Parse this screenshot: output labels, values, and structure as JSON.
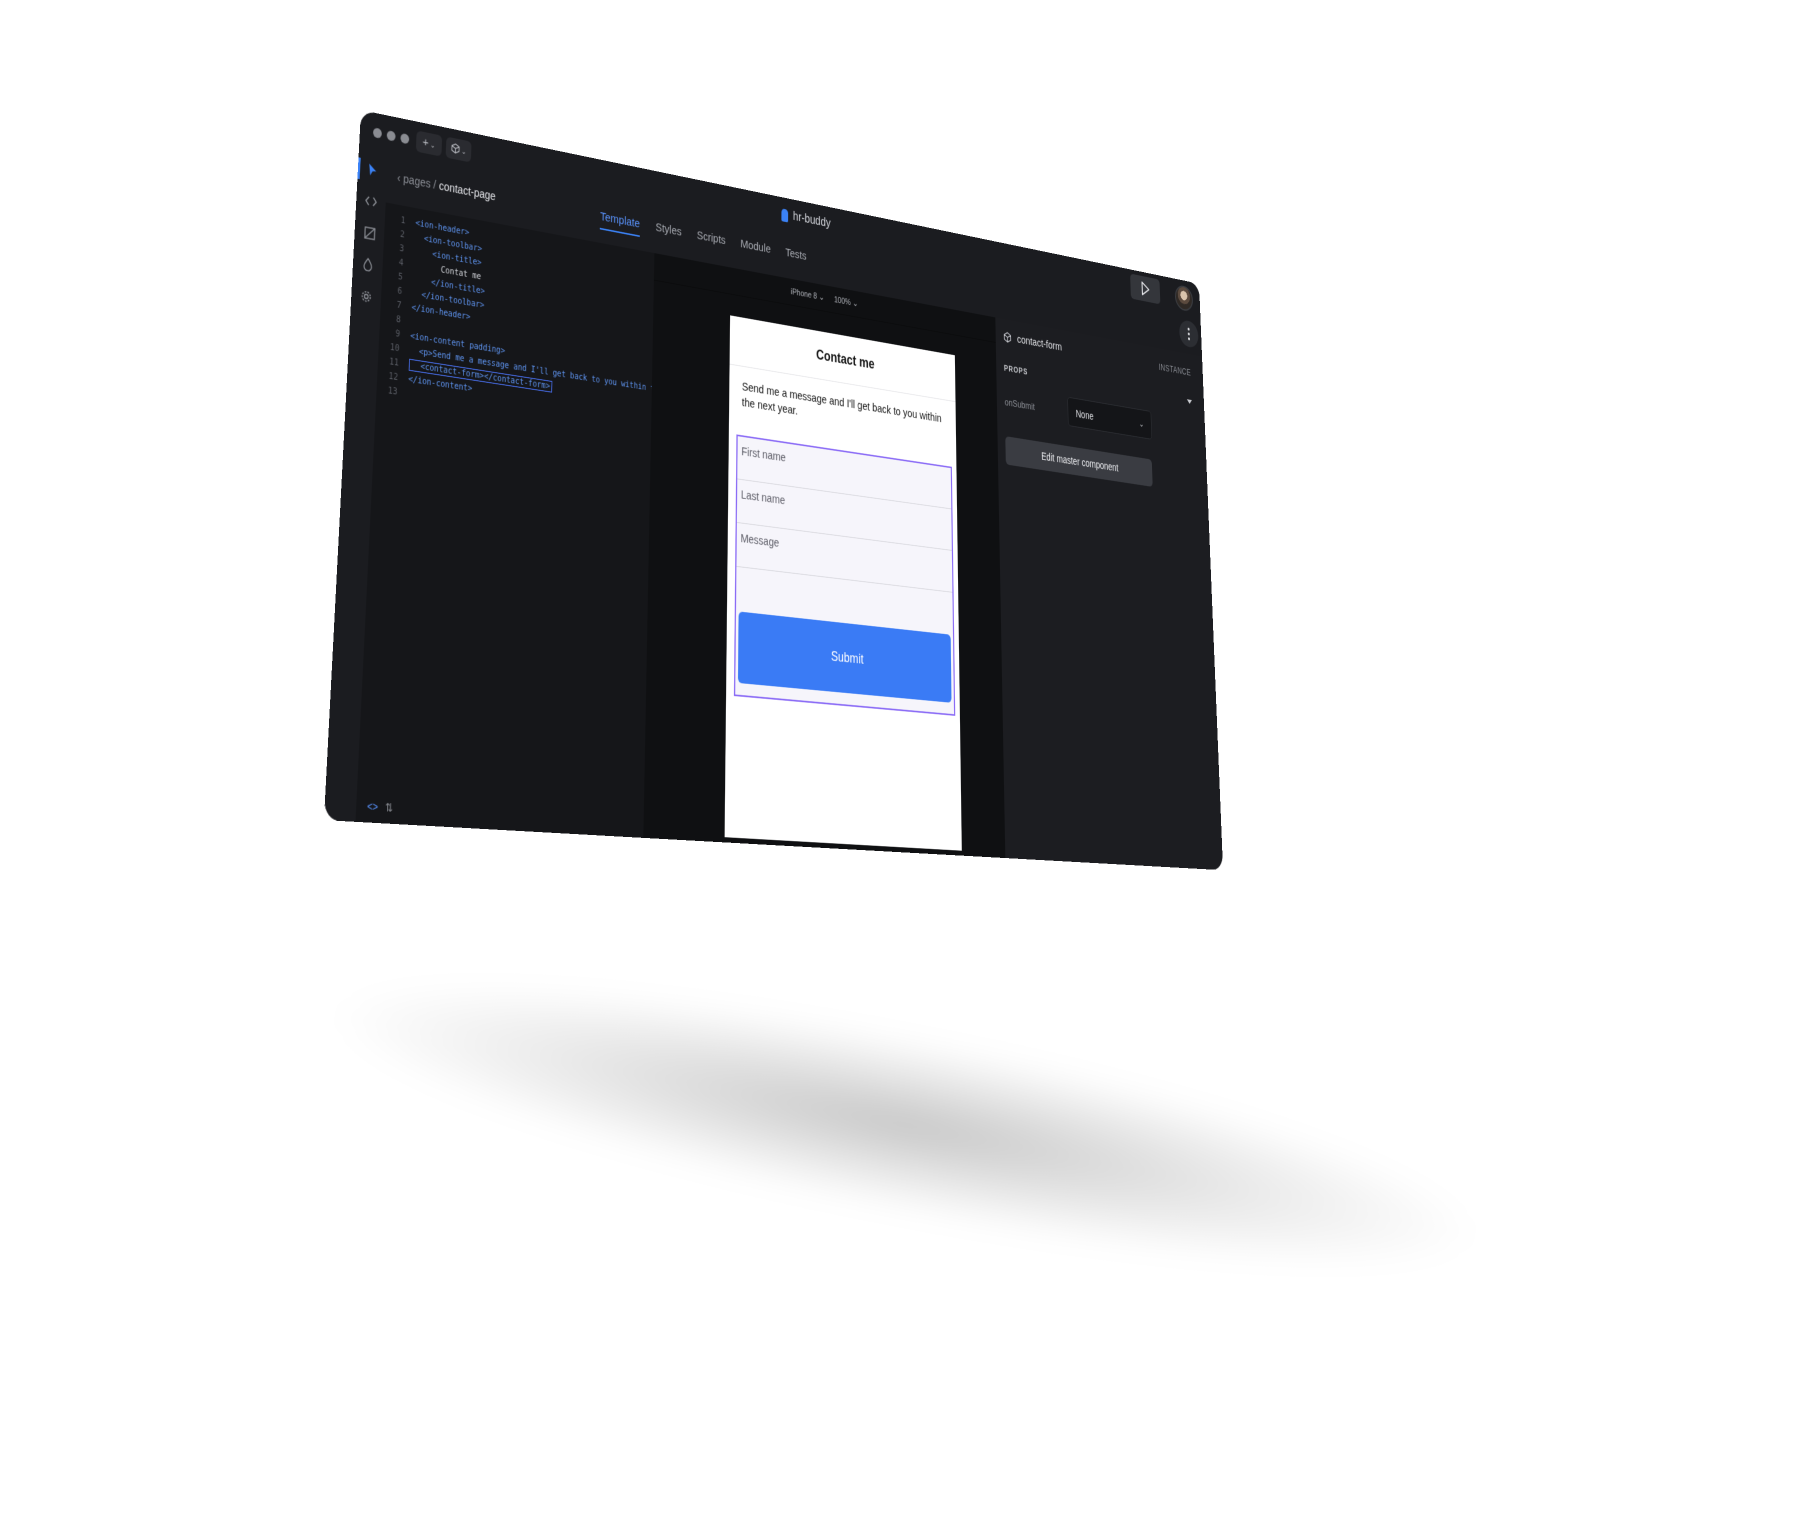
{
  "window": {
    "project_title": "hr-buddy",
    "new_button_label": "+",
    "avatar_name": "user-avatar"
  },
  "breadcrumb": {
    "parent": "pages",
    "separator": "/",
    "current": "contact-page"
  },
  "tabs": [
    {
      "label": "Template",
      "active": true
    },
    {
      "label": "Styles",
      "active": false
    },
    {
      "label": "Scripts",
      "active": false
    },
    {
      "label": "Module",
      "active": false
    },
    {
      "label": "Tests",
      "active": false
    }
  ],
  "editor": {
    "lines": [
      {
        "n": "1",
        "text": "<ion-header>"
      },
      {
        "n": "2",
        "text": "  <ion-toolbar>"
      },
      {
        "n": "3",
        "text": "    <ion-title>"
      },
      {
        "n": "4",
        "text": "      Contat me"
      },
      {
        "n": "5",
        "text": "    </ion-title>"
      },
      {
        "n": "6",
        "text": "  </ion-toolbar>"
      },
      {
        "n": "7",
        "text": "</ion-header>"
      },
      {
        "n": "8",
        "text": ""
      },
      {
        "n": "9",
        "text": "<ion-content padding>"
      },
      {
        "n": "10",
        "text": "  <p>Send me a message and I'll get back to you within the next year.</p>"
      },
      {
        "n": "11",
        "text": "  <contact-form></contact-form>"
      },
      {
        "n": "12",
        "text": "</ion-content>"
      },
      {
        "n": "13",
        "text": ""
      }
    ]
  },
  "canvas": {
    "device": "iPhone 8",
    "zoom": "100%"
  },
  "preview": {
    "title": "Contact me",
    "text": "Send me a message and I'll get back to you within the next year.",
    "fields": [
      "First name",
      "Last name",
      "Message"
    ],
    "submit_label": "Submit"
  },
  "inspector": {
    "component_name": "contact-form",
    "kind": "INSTANCE",
    "props_label": "PROPS",
    "prop_key": "onSubmit",
    "prop_value": "None",
    "edit_button_label": "Edit master component"
  },
  "colors": {
    "accent": "#3b82f6",
    "selection": "#8b6cf6",
    "submit": "#3a7bf5",
    "background": "#17181b"
  }
}
